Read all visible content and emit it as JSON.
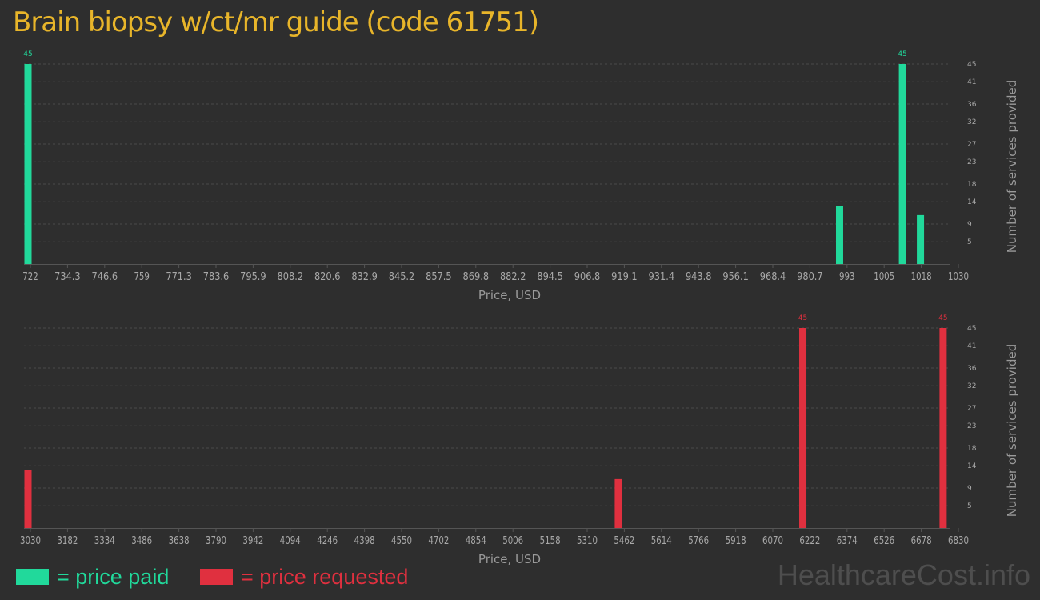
{
  "title": "Brain biopsy w/ct/mr guide (code 61751)",
  "colors": {
    "background": "#2e2e2e",
    "title": "#e8b52a",
    "paid": "#21d99b",
    "requested": "#e0303f",
    "grid": "#4a4a4a",
    "tick_text": "#a8a8a8",
    "axis_label": "#9a9a9a",
    "watermark": "#4e4e4e"
  },
  "legend": {
    "paid_label": "= price paid",
    "requested_label": "= price requested"
  },
  "watermark": "HealthcareCost.info",
  "chart_data": [
    {
      "type": "bar",
      "xlabel": "Price, USD",
      "ylabel": "Number of services provided",
      "xlim": [
        722,
        1030
      ],
      "ylim": [
        0,
        45
      ],
      "grid": true,
      "color_key": "paid",
      "x_ticks": [
        "722",
        "734.3",
        "746.6",
        "759",
        "771.3",
        "783.6",
        "795.9",
        "808.2",
        "820.6",
        "832.9",
        "845.2",
        "857.5",
        "869.8",
        "882.2",
        "894.5",
        "906.8",
        "919.1",
        "931.4",
        "943.8",
        "956.1",
        "968.4",
        "980.7",
        "993",
        "1005",
        "1018",
        "1030"
      ],
      "y_ticks": [
        "5",
        "9",
        "14",
        "18",
        "23",
        "27",
        "32",
        "36",
        "41",
        "45"
      ],
      "points": [
        {
          "x": 722,
          "y": 45,
          "label": "45"
        },
        {
          "x": 993,
          "y": 13
        },
        {
          "x": 1014,
          "y": 45,
          "label": "45"
        },
        {
          "x": 1020,
          "y": 11
        }
      ]
    },
    {
      "type": "bar",
      "xlabel": "Price, USD",
      "ylabel": "Number of services provided",
      "xlim": [
        3030,
        6830
      ],
      "ylim": [
        0,
        45
      ],
      "grid": true,
      "color_key": "requested",
      "x_ticks": [
        "3030",
        "3182",
        "3334",
        "3486",
        "3638",
        "3790",
        "3942",
        "4094",
        "4246",
        "4398",
        "4550",
        "4702",
        "4854",
        "5006",
        "5158",
        "5310",
        "5462",
        "5614",
        "5766",
        "5918",
        "6070",
        "6222",
        "6374",
        "6526",
        "6678",
        "6830"
      ],
      "y_ticks": [
        "5",
        "9",
        "14",
        "18",
        "23",
        "27",
        "32",
        "36",
        "41",
        "45"
      ],
      "points": [
        {
          "x": 3030,
          "y": 13
        },
        {
          "x": 5462,
          "y": 11
        },
        {
          "x": 6222,
          "y": 45,
          "label": "45"
        },
        {
          "x": 6800,
          "y": 45,
          "label": "45"
        }
      ]
    }
  ]
}
